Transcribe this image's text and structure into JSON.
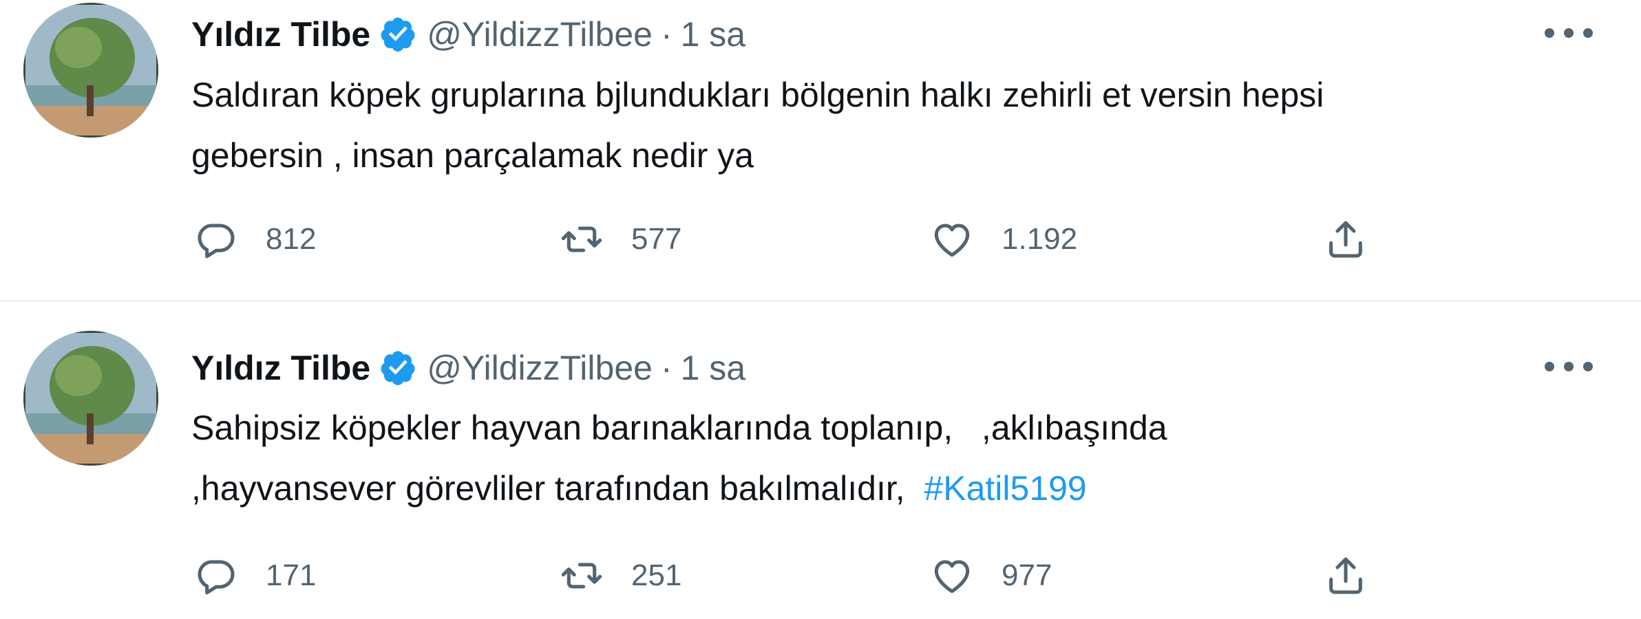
{
  "tweets": [
    {
      "author_name": "Yıldız Tilbe",
      "handle": "@YildizzTilbee",
      "separator": "·",
      "time": "1 sa",
      "text_lines": [
        "Saldıran köpek gruplarına bjlundukları bölgenin halkı zehirli et versin hepsi",
        "gebersin , insan parçalamak nedir ya"
      ],
      "hashtag": "",
      "replies": "812",
      "retweets": "577",
      "likes": "1.192"
    },
    {
      "author_name": "Yıldız Tilbe",
      "handle": "@YildizzTilbee",
      "separator": "·",
      "time": "1 sa",
      "text_lines": [
        "Sahipsiz köpekler hayvan barınaklarında toplanıp,   ,aklıbaşında",
        ",hayvansever görevliler tarafından bakılmalıdır,  "
      ],
      "hashtag": "#Katil5199",
      "replies": "171",
      "retweets": "251",
      "likes": "977"
    }
  ],
  "colors": {
    "text": "#0f1419",
    "secondary": "#536471",
    "accent": "#1d9bf0",
    "divider": "#eff3f4"
  },
  "icons": {
    "verified": "verified-badge-icon",
    "more": "more-options-icon",
    "reply": "reply-icon",
    "retweet": "retweet-icon",
    "like": "heart-icon",
    "share": "share-icon"
  }
}
